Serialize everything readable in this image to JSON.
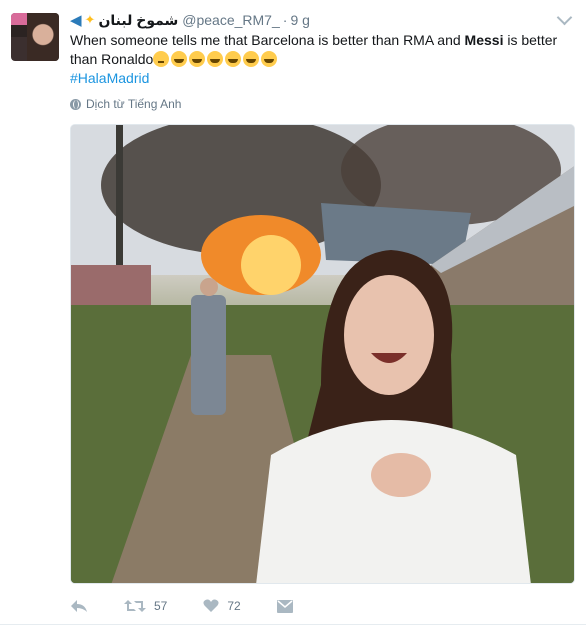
{
  "tweet": {
    "display_name": "شموخ لبنان",
    "handle": "@peace_RM7_",
    "separator": "·",
    "time": "9 g",
    "text_1": "When someone tells me that Barcelona is better than RMA and ",
    "text_bold": "Messi",
    "text_2": " is better than Ronaldo",
    "hashtag": "#HalaMadrid",
    "translate_label": "Dịch từ Tiếng Anh"
  },
  "actions": {
    "retweet_count": "57",
    "like_count": "72"
  },
  "icons": [
    "dolphin-icon",
    "sparkles-icon",
    "chevron-down-icon",
    "globe-icon",
    "reply-icon",
    "retweet-icon",
    "heart-icon",
    "message-icon"
  ],
  "colors": {
    "link": "#1b95e0",
    "muted": "#657786",
    "action": "#aab8c2"
  }
}
